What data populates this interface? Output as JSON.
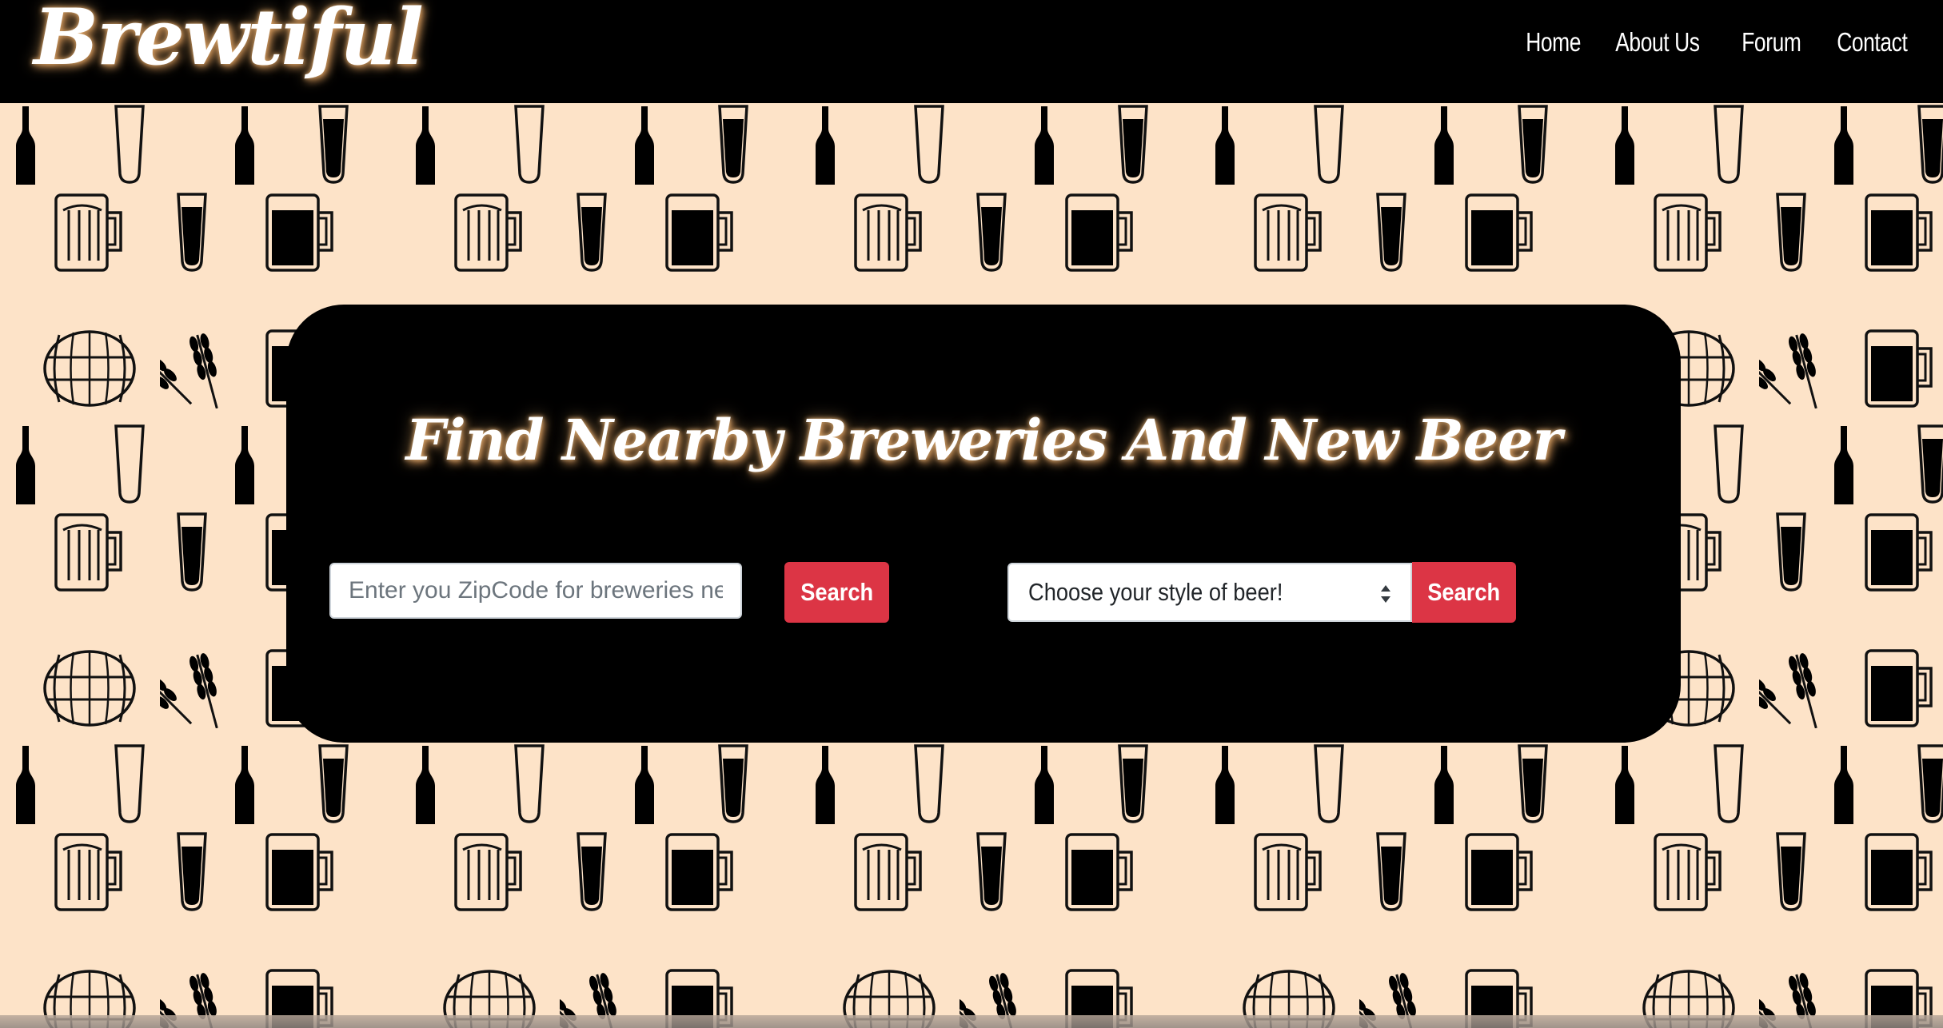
{
  "page": {
    "background_color": "#fde3c8",
    "accent_color": "#dc3545"
  },
  "navbar": {
    "brand": "Brewtiful",
    "links": [
      {
        "label": "Home"
      },
      {
        "label": "About Us"
      },
      {
        "label": "Forum"
      },
      {
        "label": "Contact"
      }
    ]
  },
  "hero": {
    "title": "Find Nearby Breweries And New Beer",
    "zip_search": {
      "placeholder": "Enter you ZipCode for breweries near you",
      "value": "",
      "button_label": "Search"
    },
    "style_search": {
      "selected": "Choose your style of beer!",
      "button_label": "Search"
    }
  },
  "background_icons": [
    "bottle-icon",
    "pint-glass-icon",
    "mug-icon",
    "barrel-icon",
    "wheat-icon"
  ]
}
